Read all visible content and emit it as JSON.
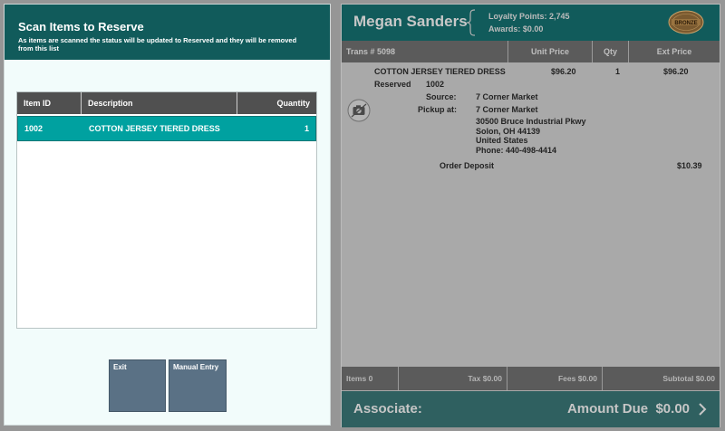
{
  "scan_panel": {
    "title": "Scan Items to Reserve",
    "subtitle": "As items are scanned the status will be updated to Reserved and they will be removed from this list",
    "columns": [
      "Item ID",
      "Description",
      "Quantity"
    ],
    "rows": [
      {
        "item_id": "1002",
        "description": "COTTON JERSEY TIERED DRESS",
        "quantity": "1"
      }
    ],
    "exit_label": "Exit",
    "manual_entry_label": "Manual Entry"
  },
  "customer": {
    "name": "Megan Sanders",
    "loyalty_points": "Loyalty Points: 2,745",
    "awards": "Awards: $0.00",
    "tier_badge": "BRONZE",
    "badge_color": "#9a6a2a"
  },
  "transaction": {
    "trans_label": "Trans # 5098",
    "columns": [
      "Unit Price",
      "Qty",
      "Ext Price"
    ],
    "item": {
      "description": "COTTON JERSEY TIERED DRESS",
      "unit_price": "$96.20",
      "qty": "1",
      "ext_price": "$96.20",
      "status": "Reserved",
      "status_id": "1002",
      "source_label": "Source:",
      "source_value": "7 Corner Market",
      "pickup_label": "Pickup at:",
      "pickup_value": "7 Corner Market",
      "address_line1": "30500 Bruce Industrial Pkwy",
      "address_line2": "Solon, OH 44139",
      "address_line3": "United States",
      "address_line4": "Phone: 440-498-4414"
    },
    "deposit_label": "Order Deposit",
    "deposit_value": "$10.39"
  },
  "totals": {
    "items": "Items 0",
    "tax": "Tax $0.00",
    "fees": "Fees $0.00",
    "subtotal": "Subtotal $0.00"
  },
  "footer": {
    "associate": "Associate:",
    "amount_due": "Amount Due  $0.00"
  }
}
